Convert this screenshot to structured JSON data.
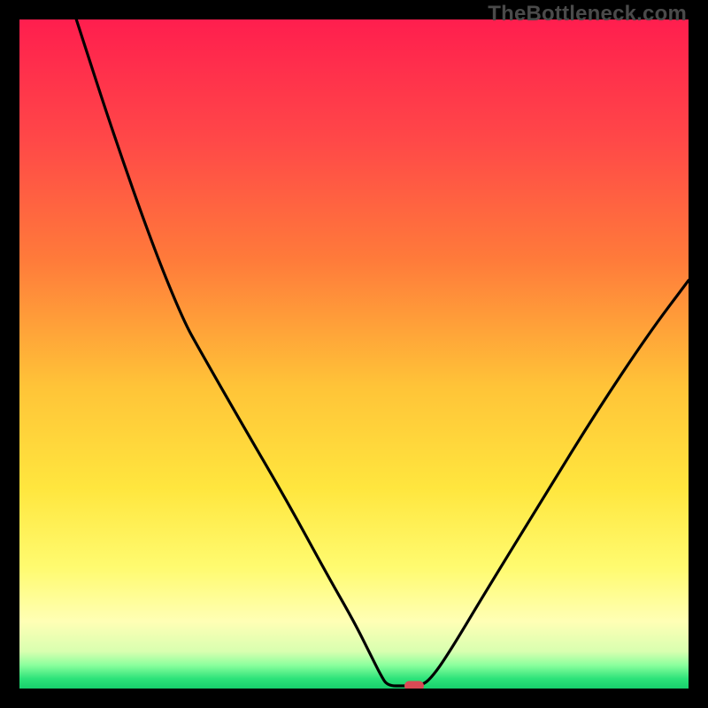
{
  "watermark": "TheBottleneck.com",
  "colors": {
    "marker": "#d94a55",
    "curve": "#000000",
    "page_bg": "#000000"
  },
  "gradient_stops": [
    {
      "offset": 0.0,
      "color": "#ff1e4e"
    },
    {
      "offset": 0.18,
      "color": "#ff4848"
    },
    {
      "offset": 0.36,
      "color": "#ff7b3a"
    },
    {
      "offset": 0.55,
      "color": "#ffc438"
    },
    {
      "offset": 0.7,
      "color": "#ffe63e"
    },
    {
      "offset": 0.82,
      "color": "#fffb70"
    },
    {
      "offset": 0.9,
      "color": "#ffffb5"
    },
    {
      "offset": 0.945,
      "color": "#d8ffb0"
    },
    {
      "offset": 0.965,
      "color": "#8bff9d"
    },
    {
      "offset": 0.985,
      "color": "#2ee37a"
    },
    {
      "offset": 1.0,
      "color": "#17cf6c"
    }
  ],
  "chart_data": {
    "type": "line",
    "title": "",
    "xlabel": "",
    "ylabel": "",
    "xlim": [
      0,
      100
    ],
    "ylim": [
      0,
      100
    ],
    "grid": false,
    "series": [
      {
        "name": "bottleneck-curve",
        "points": [
          {
            "x": 8.5,
            "y": 100.0
          },
          {
            "x": 14.0,
            "y": 83.0
          },
          {
            "x": 20.0,
            "y": 66.0
          },
          {
            "x": 24.5,
            "y": 55.0
          },
          {
            "x": 27.0,
            "y": 50.5
          },
          {
            "x": 33.0,
            "y": 40.0
          },
          {
            "x": 40.0,
            "y": 28.0
          },
          {
            "x": 46.0,
            "y": 17.0
          },
          {
            "x": 50.0,
            "y": 10.0
          },
          {
            "x": 52.5,
            "y": 5.0
          },
          {
            "x": 54.0,
            "y": 2.0
          },
          {
            "x": 55.0,
            "y": 0.4
          },
          {
            "x": 57.5,
            "y": 0.4
          },
          {
            "x": 60.0,
            "y": 0.4
          },
          {
            "x": 61.5,
            "y": 1.5
          },
          {
            "x": 64.0,
            "y": 5.0
          },
          {
            "x": 70.0,
            "y": 15.0
          },
          {
            "x": 78.0,
            "y": 28.0
          },
          {
            "x": 86.0,
            "y": 41.0
          },
          {
            "x": 94.0,
            "y": 53.0
          },
          {
            "x": 100.0,
            "y": 61.0
          }
        ]
      }
    ],
    "marker": {
      "x": 59.0,
      "y": 0.4,
      "label": "optimal-point"
    }
  }
}
